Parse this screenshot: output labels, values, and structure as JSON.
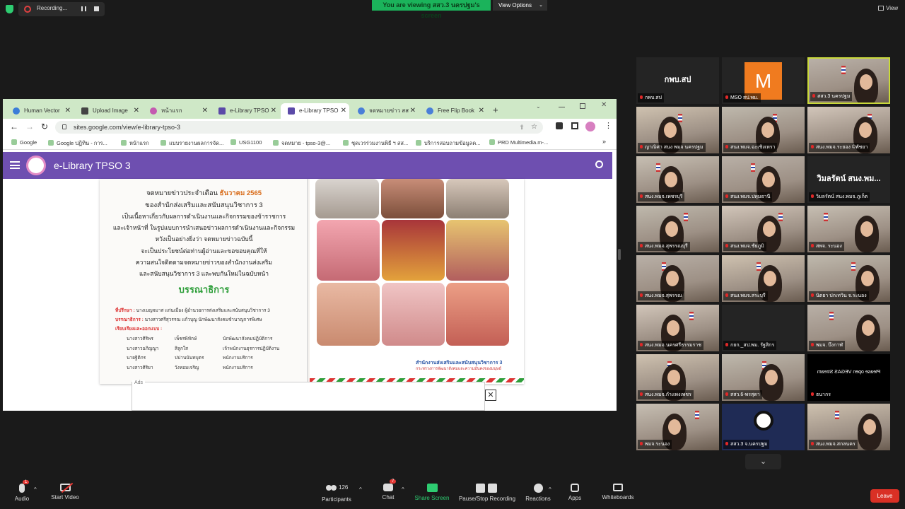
{
  "meeting": {
    "recording_label": "Recording...",
    "viewing_prefix": "You are viewing",
    "viewing_name": "สสว.3 นครปฐม's screen",
    "view_options_label": "View Options",
    "view_label": "View"
  },
  "browser": {
    "tabs": [
      {
        "label": "Human Vector",
        "icon_color": "#3b7dd8"
      },
      {
        "label": "Upload Image",
        "icon_color": "#444"
      },
      {
        "label": "หน้าแรก",
        "icon_color": "#c45ab0"
      },
      {
        "label": "e-Library TPSO",
        "icon_color": "#5b4aa8"
      },
      {
        "label": "e-Library TPSO",
        "icon_color": "#5b4aa8"
      },
      {
        "label": "จดหมายข่าว สส",
        "icon_color": "#4a7fd8"
      },
      {
        "label": "Free Flip Book",
        "icon_color": "#4a7fd8"
      }
    ],
    "url": "sites.google.com/view/e-library-tpso-3",
    "bookmarks": [
      "Google",
      "Google ปฏิทิน - การ...",
      "หน้าแรก",
      "แบบรายงานผลการจัด...",
      "USG1100",
      "จดหมาย - tpso-3@...",
      "ชุดเวรร่วมงานพิธี ฯ สส...",
      "บริการสอบถามข้อมูลค...",
      "PRD Multimedia.m-..."
    ],
    "site_title": "e-Library TPSO 3",
    "ads_label": "Ads",
    "ads_close": "✕"
  },
  "newsletter": {
    "line1": "จดหมายข่าวประจำเดือน",
    "month": "ธันวาคม 2565",
    "line2": "ของสำนักส่งเสริมและสนับสนุนวิชาการ 3",
    "line3": "เป็นเนื้อหาเกี่ยวกับผลการดำเนินงานและกิจกรรมของข้าราชการ",
    "line4": "และเจ้าหน้าที่ ในรูปแบบการนำเสนอข่าวผลการดำเนินงานและกิจกรรม",
    "line5": "หวังเป็นอย่างยิ่งว่า จดหมายข่าวฉบับนี้",
    "line6": "จะเป็นประโยชน์ต่อท่านผู้อ่านและขอขอบคุณที่ให้",
    "line7": "ความสนใจติดตามจดหมายข่าวของสำนักงานส่งเสริม",
    "line8": "และสนับสนุนวิชาการ 3 และพบกันใหม่ในฉบับหน้า",
    "editorial": "บรรณาธิการ",
    "advisor_label": "ที่ปรึกษา :",
    "advisor": "นางเบญจมาส แก่นเมือง ผู้อำนวยการส่งเสริมและสนับสนุนวิชาการ 3",
    "editor_label": "บรรณาธิการ :",
    "editor": "นางสาวศรีสุวรรณ แก้วบุญ นักพัฒนาสังคมชำนาญการพิเศษ",
    "staff_label": "เรียบเรียงและออกแบบ :",
    "staff": [
      [
        "นางสาวศิริพร",
        "เพ็ชรพิทักษ์",
        "นักพัฒนาสังคมปฏิบัติการ"
      ],
      [
        "นางสาวอภิญญา",
        "สิลูกใส",
        "เจ้าพนักงานธุรการปฏิบัติงาน"
      ],
      [
        "นายฐิติกร",
        "ปปานนันทบุตร",
        "พนักงานบริการ"
      ],
      [
        "นางสาวศิริยา",
        "วังหอมเจริญ",
        "พนักงานบริการ"
      ]
    ],
    "footer_org": "สำนักงานส่งเสริมและสนับสนุนวิชาการ 3",
    "footer_ministry": "กระทรวงการพัฒนาสังคมและความมั่นคงของมนุษย์"
  },
  "participants": [
    {
      "name": "กพบ.สป",
      "big": "กพบ.สป",
      "kind": "name"
    },
    {
      "name": "MSO สป.พม.",
      "kind": "logo",
      "logo_letter": "M",
      "logo_color": "#f07b1f"
    },
    {
      "name": "สสว.3 นครปฐม",
      "kind": "cam",
      "active": true
    },
    {
      "name": "ญาณิศา สนง พมจ นครปฐม",
      "kind": "cam"
    },
    {
      "name": "สนง.พมจ.ฉะเชิงเทรา",
      "kind": "cam"
    },
    {
      "name": "สนง.พมจ.ระยอง ©พัชยา",
      "kind": "cam"
    },
    {
      "name": "สนง.พมจ.เพชรบุรี",
      "kind": "cam"
    },
    {
      "name": "สนง.พมจ.ปทุมธานี",
      "kind": "cam"
    },
    {
      "name": "วิมลรัตน์ สนง.พมจ.ภูเก็ต",
      "big": "วิมลรัตน์ สนง.พม...",
      "kind": "name"
    },
    {
      "name": "สนง.พมจ.สุพรรณบุรี",
      "kind": "cam"
    },
    {
      "name": "สนง.พมจ.ชัยภูมิ",
      "kind": "cam"
    },
    {
      "name": "สพจ. ระนอง",
      "kind": "cam"
    },
    {
      "name": "สนง.พมจ.สุพรรณ",
      "kind": "cam"
    },
    {
      "name": "สนง.พมจ.สระบุรี",
      "kind": "cam"
    },
    {
      "name": "นิตยา ปกเทวิน จ.ระนอง",
      "kind": "cam"
    },
    {
      "name": "สนง.พมจ.นครศรีธรรมราช",
      "kind": "cam"
    },
    {
      "name": "กยก._สป.พม. รัฐสิกร",
      "kind": "empty"
    },
    {
      "name": "พมจ. บึงกาฬ",
      "kind": "cam"
    },
    {
      "name": "สนง.พมจ.กำแพงเพชร",
      "kind": "cam"
    },
    {
      "name": "สสว.6-พรสุดา",
      "kind": "cam"
    },
    {
      "name": "ธนากร",
      "big": "Please open VEGAS Stream",
      "kind": "mirror"
    },
    {
      "name": "พมจ.ระนอง",
      "kind": "cam"
    },
    {
      "name": "สสว.3 จ.นครปฐม",
      "kind": "obs"
    },
    {
      "name": "สนง.พมจ.สกลนคร",
      "kind": "cam"
    }
  ],
  "toolbar": {
    "audio": "Audio",
    "start_video": "Start Video",
    "participants": "Participants",
    "participant_count": "126",
    "chat": "Chat",
    "chat_badge": "7",
    "share_screen": "Share Screen",
    "pause_recording": "Pause/Stop Recording",
    "reactions": "Reactions",
    "apps": "Apps",
    "whiteboards": "Whiteboards",
    "leave": "Leave",
    "audio_badge": "1"
  }
}
